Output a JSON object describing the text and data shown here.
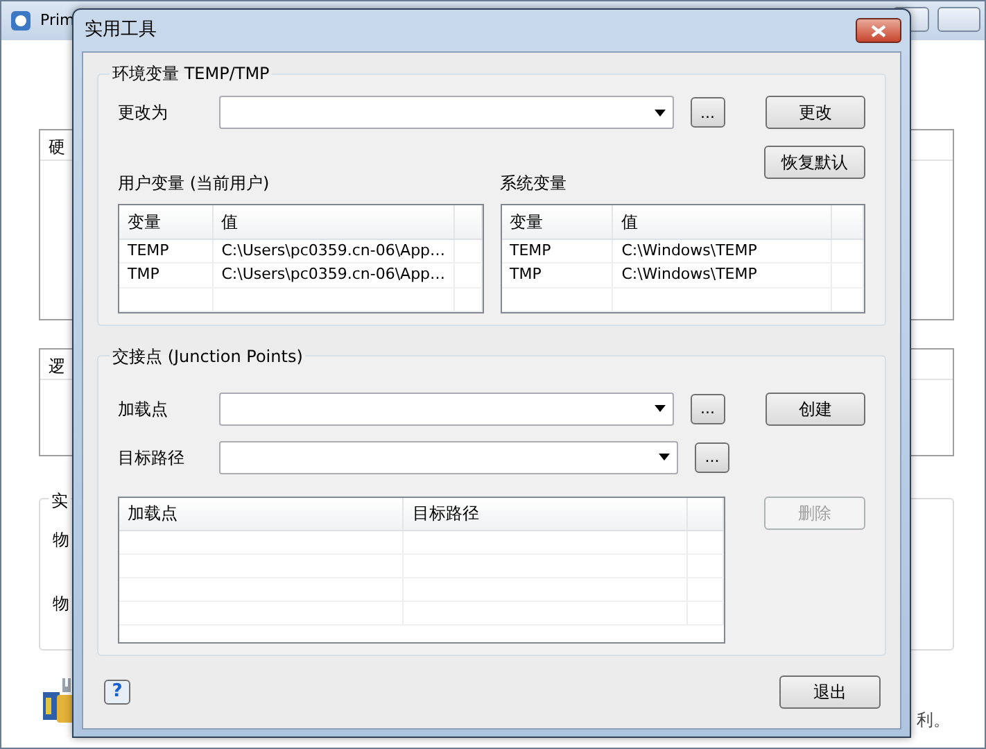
{
  "background_window": {
    "title": "Prim",
    "disk_list_header": "硬",
    "logical_list_header": "逻",
    "group_label": "实",
    "rows": [
      "物",
      "物"
    ],
    "footer_text": "利。"
  },
  "dialog": {
    "title": "实用工具",
    "env_group": {
      "legend": "环境变量 TEMP/TMP",
      "change_to": {
        "label": "更改为",
        "browse": "..."
      },
      "buttons": [
        {
          "label": "更改",
          "disabled": false
        },
        {
          "label": "恢复默认",
          "disabled": false
        }
      ],
      "user_vars": {
        "label": "用户变量 (当前用户)",
        "columns": [
          "变量",
          "值"
        ],
        "rows": [
          [
            "TEMP",
            "C:\\Users\\pc0359.cn-06\\App…"
          ],
          [
            "TMP",
            "C:\\Users\\pc0359.cn-06\\App…"
          ]
        ]
      },
      "system_vars": {
        "label": "系统变量",
        "columns": [
          "变量",
          "值"
        ],
        "rows": [
          [
            "TEMP",
            "C:\\Windows\\TEMP"
          ],
          [
            "TMP",
            "C:\\Windows\\TEMP"
          ]
        ]
      }
    },
    "junction_group": {
      "legend": "交接点 (Junction Points)",
      "fields": [
        {
          "label": "加载点",
          "browse": "..."
        },
        {
          "label": "目标路径",
          "browse": "..."
        }
      ],
      "buttons": [
        {
          "label": "创建",
          "disabled": false
        },
        {
          "label": "删除",
          "disabled": true
        }
      ],
      "table": {
        "columns": [
          "加载点",
          "目标路径"
        ]
      }
    },
    "help_button": "?",
    "exit_button": "退出"
  }
}
